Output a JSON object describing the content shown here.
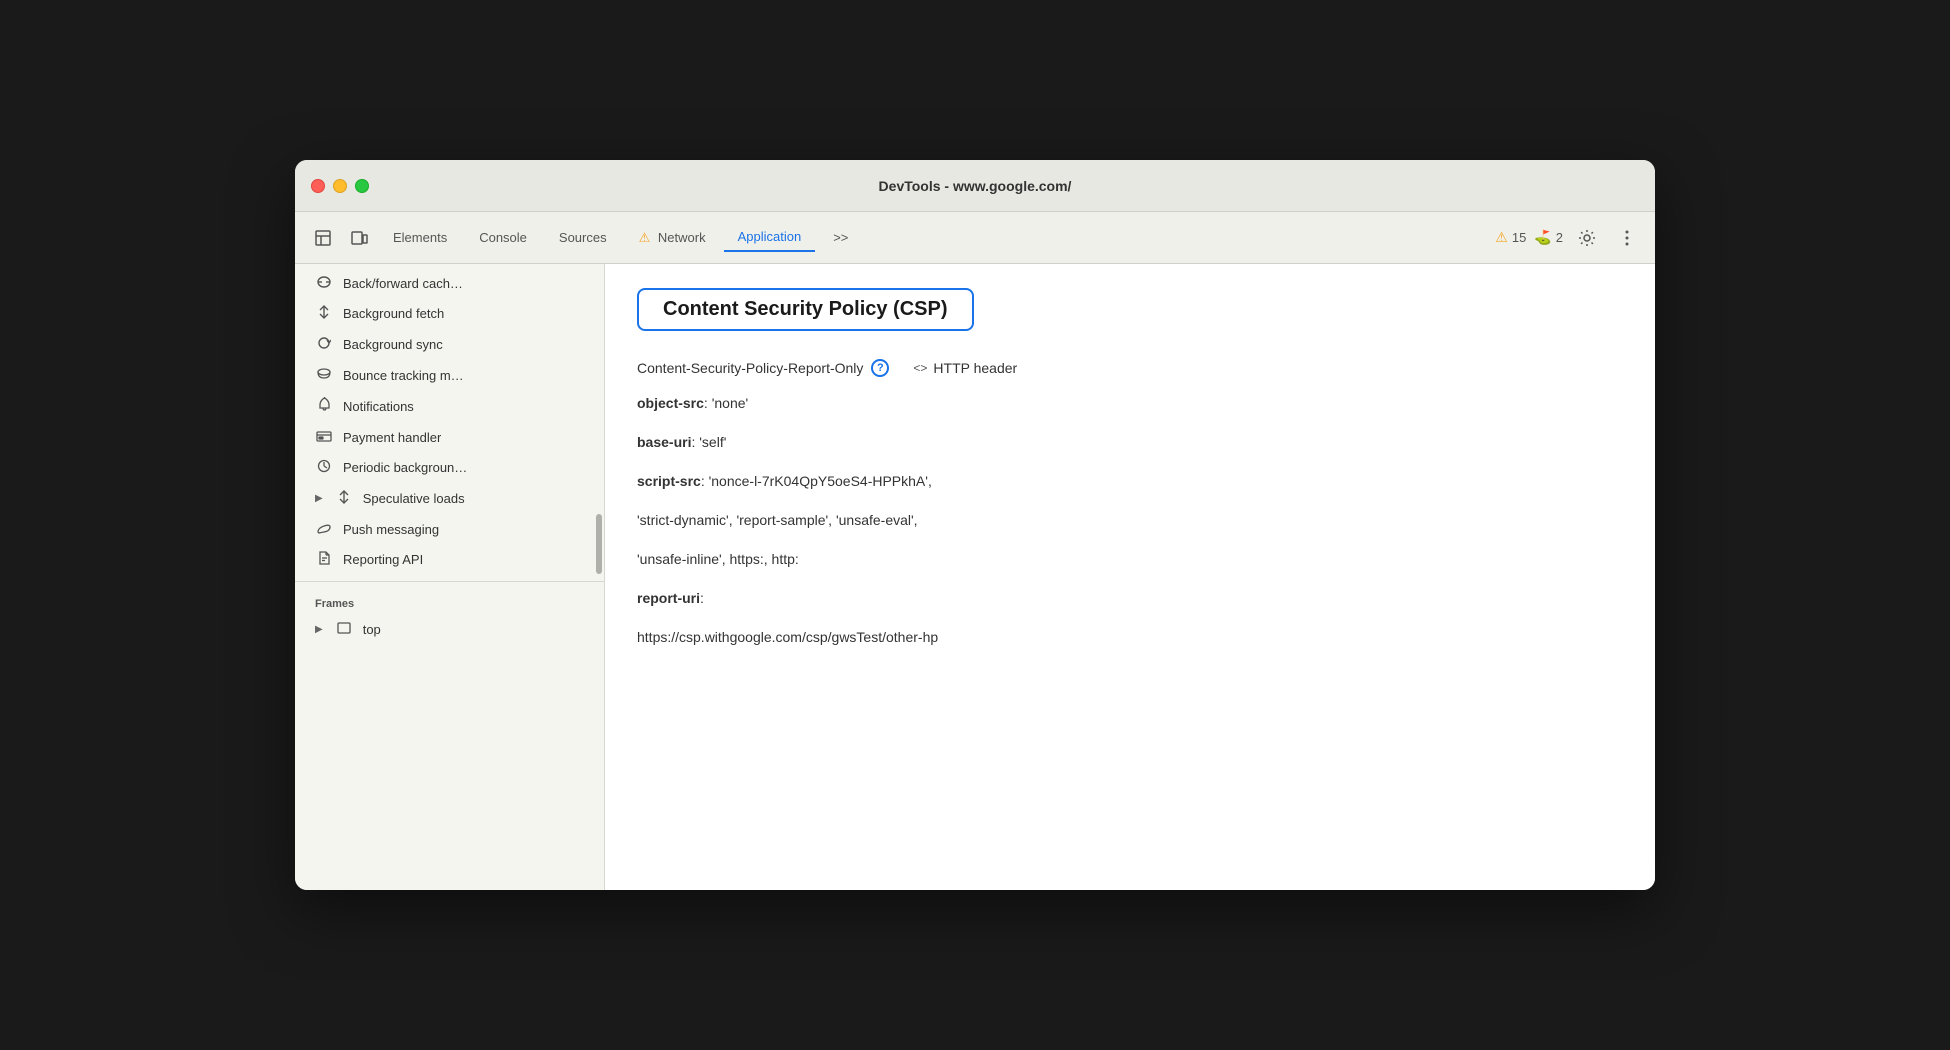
{
  "window": {
    "title": "DevTools - www.google.com/"
  },
  "toolbar": {
    "elements_label": "Elements",
    "console_label": "Console",
    "sources_label": "Sources",
    "network_label": "Network",
    "application_label": "Application",
    "more_label": ">>",
    "warnings_count": "15",
    "errors_count": "2"
  },
  "sidebar": {
    "items": [
      {
        "id": "back-forward",
        "label": "Back/forward cach…",
        "icon": "🗄"
      },
      {
        "id": "background-fetch",
        "label": "Background fetch",
        "icon": "↕"
      },
      {
        "id": "background-sync",
        "label": "Background sync",
        "icon": "↻"
      },
      {
        "id": "bounce-tracking",
        "label": "Bounce tracking m…",
        "icon": "🗄"
      },
      {
        "id": "notifications",
        "label": "Notifications",
        "icon": "🔔"
      },
      {
        "id": "payment-handler",
        "label": "Payment handler",
        "icon": "💳"
      },
      {
        "id": "periodic-background",
        "label": "Periodic backgroun…",
        "icon": "⏱"
      },
      {
        "id": "speculative-loads",
        "label": "Speculative loads",
        "icon": "↕",
        "expandable": true
      },
      {
        "id": "push-messaging",
        "label": "Push messaging",
        "icon": "☁"
      },
      {
        "id": "reporting-api",
        "label": "Reporting API",
        "icon": "📄"
      }
    ],
    "frames_section": "Frames",
    "frames_top": "top"
  },
  "content": {
    "csp_title": "Content Security Policy (CSP)",
    "policy_label": "Content-Security-Policy-Report-Only",
    "http_header_label": "HTTP header",
    "details": [
      {
        "key": "object-src",
        "value": "'none'"
      },
      {
        "key": "base-uri",
        "value": "'self'"
      },
      {
        "key": "script-src",
        "value": "'nonce-l-7rK04QpY5oeS4-HPPkhA', 'strict-dynamic', 'report-sample', 'unsafe-eval',"
      },
      {
        "key": "",
        "value": "'unsafe-inline', https:, http:"
      },
      {
        "key": "report-uri",
        "value": ""
      },
      {
        "key": "",
        "value": "https://csp.withgoogle.com/csp/gwsTest/other-hp"
      }
    ]
  }
}
